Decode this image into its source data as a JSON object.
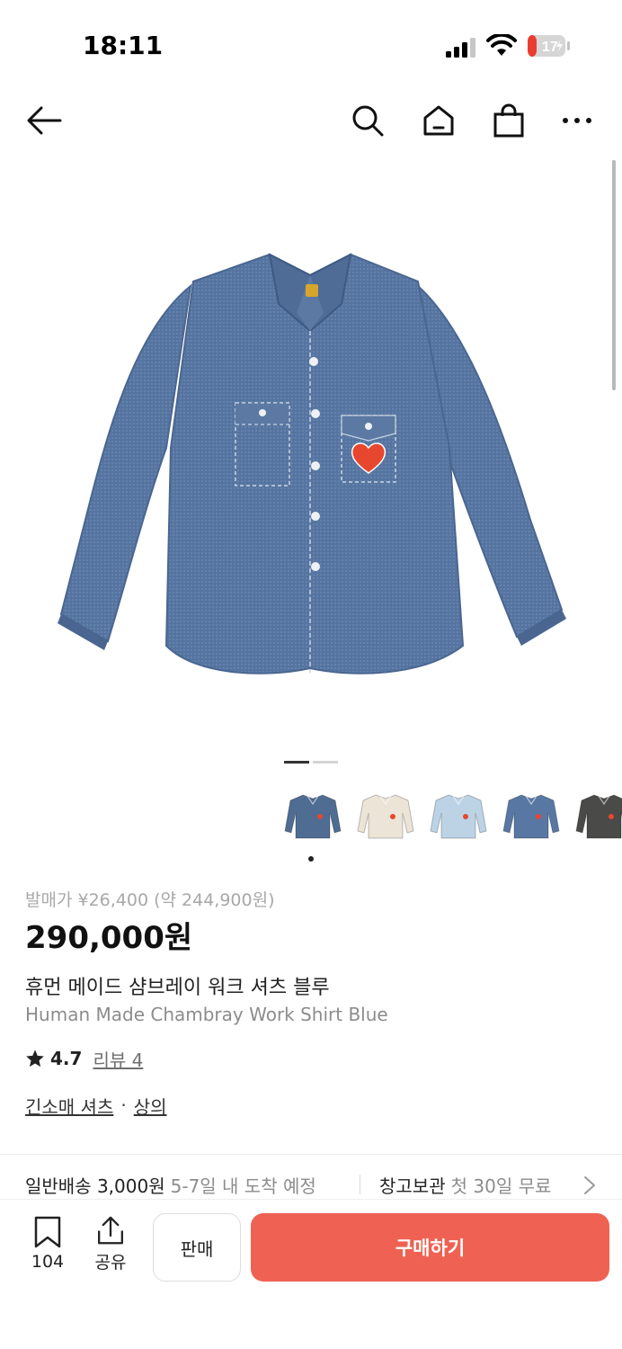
{
  "status_bar": {
    "time": "18:11",
    "battery_level": "17"
  },
  "nav": {
    "icons": [
      "back-arrow-icon",
      "search-icon",
      "home-icon",
      "shopping-bag-icon",
      "more-icon"
    ]
  },
  "gallery": {
    "image_count": 2,
    "active_index": 0
  },
  "thumbnails": [
    {
      "name": "thumb-blue-chambray",
      "color": "#4f6c92"
    },
    {
      "name": "thumb-ecru",
      "color": "#ece4d7"
    },
    {
      "name": "thumb-light-blue",
      "color": "#bcd3e6"
    },
    {
      "name": "thumb-denim-blue",
      "color": "#5877a3"
    },
    {
      "name": "thumb-charcoal",
      "color": "#4a4a48"
    }
  ],
  "product": {
    "original_price": "발매가 ¥26,400 (약 244,900원)",
    "price": "290,000원",
    "name_ko": "휴먼 메이드 샴브레이 워크 셔츠 블루",
    "name_en": "Human Made Chambray Work Shirt Blue",
    "rating": "4.7",
    "review_label": "리뷰 4",
    "categories": [
      "긴소매 셔츠",
      "상의"
    ],
    "category_sep": "·"
  },
  "shipping": {
    "label": "일반배송 3,000원",
    "time": "5-7일 내 도착 예정",
    "storage_label": "창고보관",
    "storage_sub": "첫 30일 무료"
  },
  "bottom_bar": {
    "bookmark_count": "104",
    "share_label": "공유",
    "sell_label": "판매",
    "buy_label": "구매하기"
  },
  "colors": {
    "buy_button": "#ef6253",
    "shirt": "#5674a0",
    "heart_patch": "#e8472f"
  }
}
